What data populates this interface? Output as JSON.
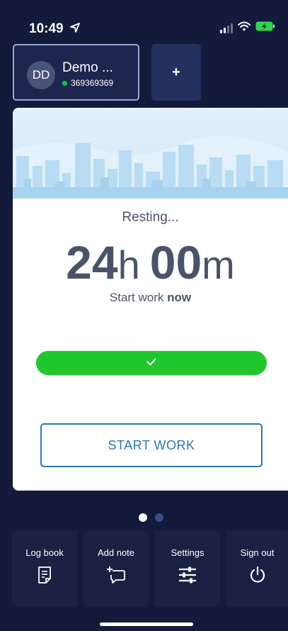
{
  "status_bar": {
    "time": "10:49",
    "icons": [
      "location-arrow-icon",
      "signal-icon",
      "wifi-icon",
      "battery-charging-icon"
    ]
  },
  "driver": {
    "initials": "DD",
    "name": "Demo ...",
    "id": "369369369",
    "status_color": "#19c23a"
  },
  "add_driver": {
    "label": "+"
  },
  "main": {
    "status": "Resting...",
    "timer": {
      "hours": "24",
      "hours_unit": "h",
      "minutes": "00",
      "minutes_unit": "m"
    },
    "subtitle_prefix": "Start work",
    "subtitle_emphasis": "now",
    "progress": {
      "fraction": 1.0,
      "color": "#21c82d",
      "icon": "check-icon"
    },
    "start_button": "START WORK"
  },
  "pager": {
    "pages": 2,
    "active": 0
  },
  "bottom_nav": [
    {
      "label": "Log book",
      "icon": "logbook-icon"
    },
    {
      "label": "Add note",
      "icon": "add-note-icon"
    },
    {
      "label": "Settings",
      "icon": "settings-sliders-icon"
    },
    {
      "label": "Sign out",
      "icon": "power-icon"
    }
  ],
  "colors": {
    "background": "#131a3a",
    "accent_blue": "#2a78b8",
    "text_gray": "#4a5468"
  }
}
